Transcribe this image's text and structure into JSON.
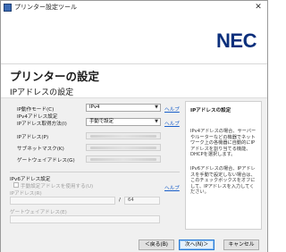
{
  "window": {
    "title": "プリンター設定ツール",
    "close_glyph": "✕"
  },
  "brand": {
    "logo": "NEC"
  },
  "page": {
    "title": "プリンターの設定",
    "section": "IPアドレスの設定"
  },
  "ipv4": {
    "ip_mode_label": "IP動作モード(C)",
    "ip_mode_value": "IPv4",
    "help1": "ヘルプ",
    "group_label": "IPv4アドレス設定",
    "acquire_label": "IPアドレス取得方法(I)",
    "acquire_value": "手動で設定",
    "help2": "ヘルプ",
    "ip_label": "IPアドレス(P)",
    "subnet_label": "サブネットマスク(K)",
    "gateway_label": "ゲートウェイアドレス(G)"
  },
  "ipv6": {
    "group_label": "IPv6アドレス設定",
    "manual_checkbox_label": "手動設定アドレスを使用する(U)",
    "help": "ヘルプ",
    "ip_label": "IPアドレス(R)",
    "prefix_sep": "/",
    "prefix_value": "64",
    "gateway_label": "ゲートウェイアドレス(E)"
  },
  "side": {
    "title": "IPアドレスの設定",
    "p1": "IPv4アドレスの場合、サーバーやルーターなどの機器でネットワーク上の各機器に自動的にIPアドレスを割り当てる機能、DHCPを選択します。",
    "p2": "IPv6アドレスの場合、IPアドレスを手動で設定しない場合は、このチェックボックスをオフにして、IPアドレスを入力してください。"
  },
  "footer": {
    "back": "＜戻る(B)",
    "next": "次へ(N)＞",
    "cancel": "キャンセル"
  }
}
